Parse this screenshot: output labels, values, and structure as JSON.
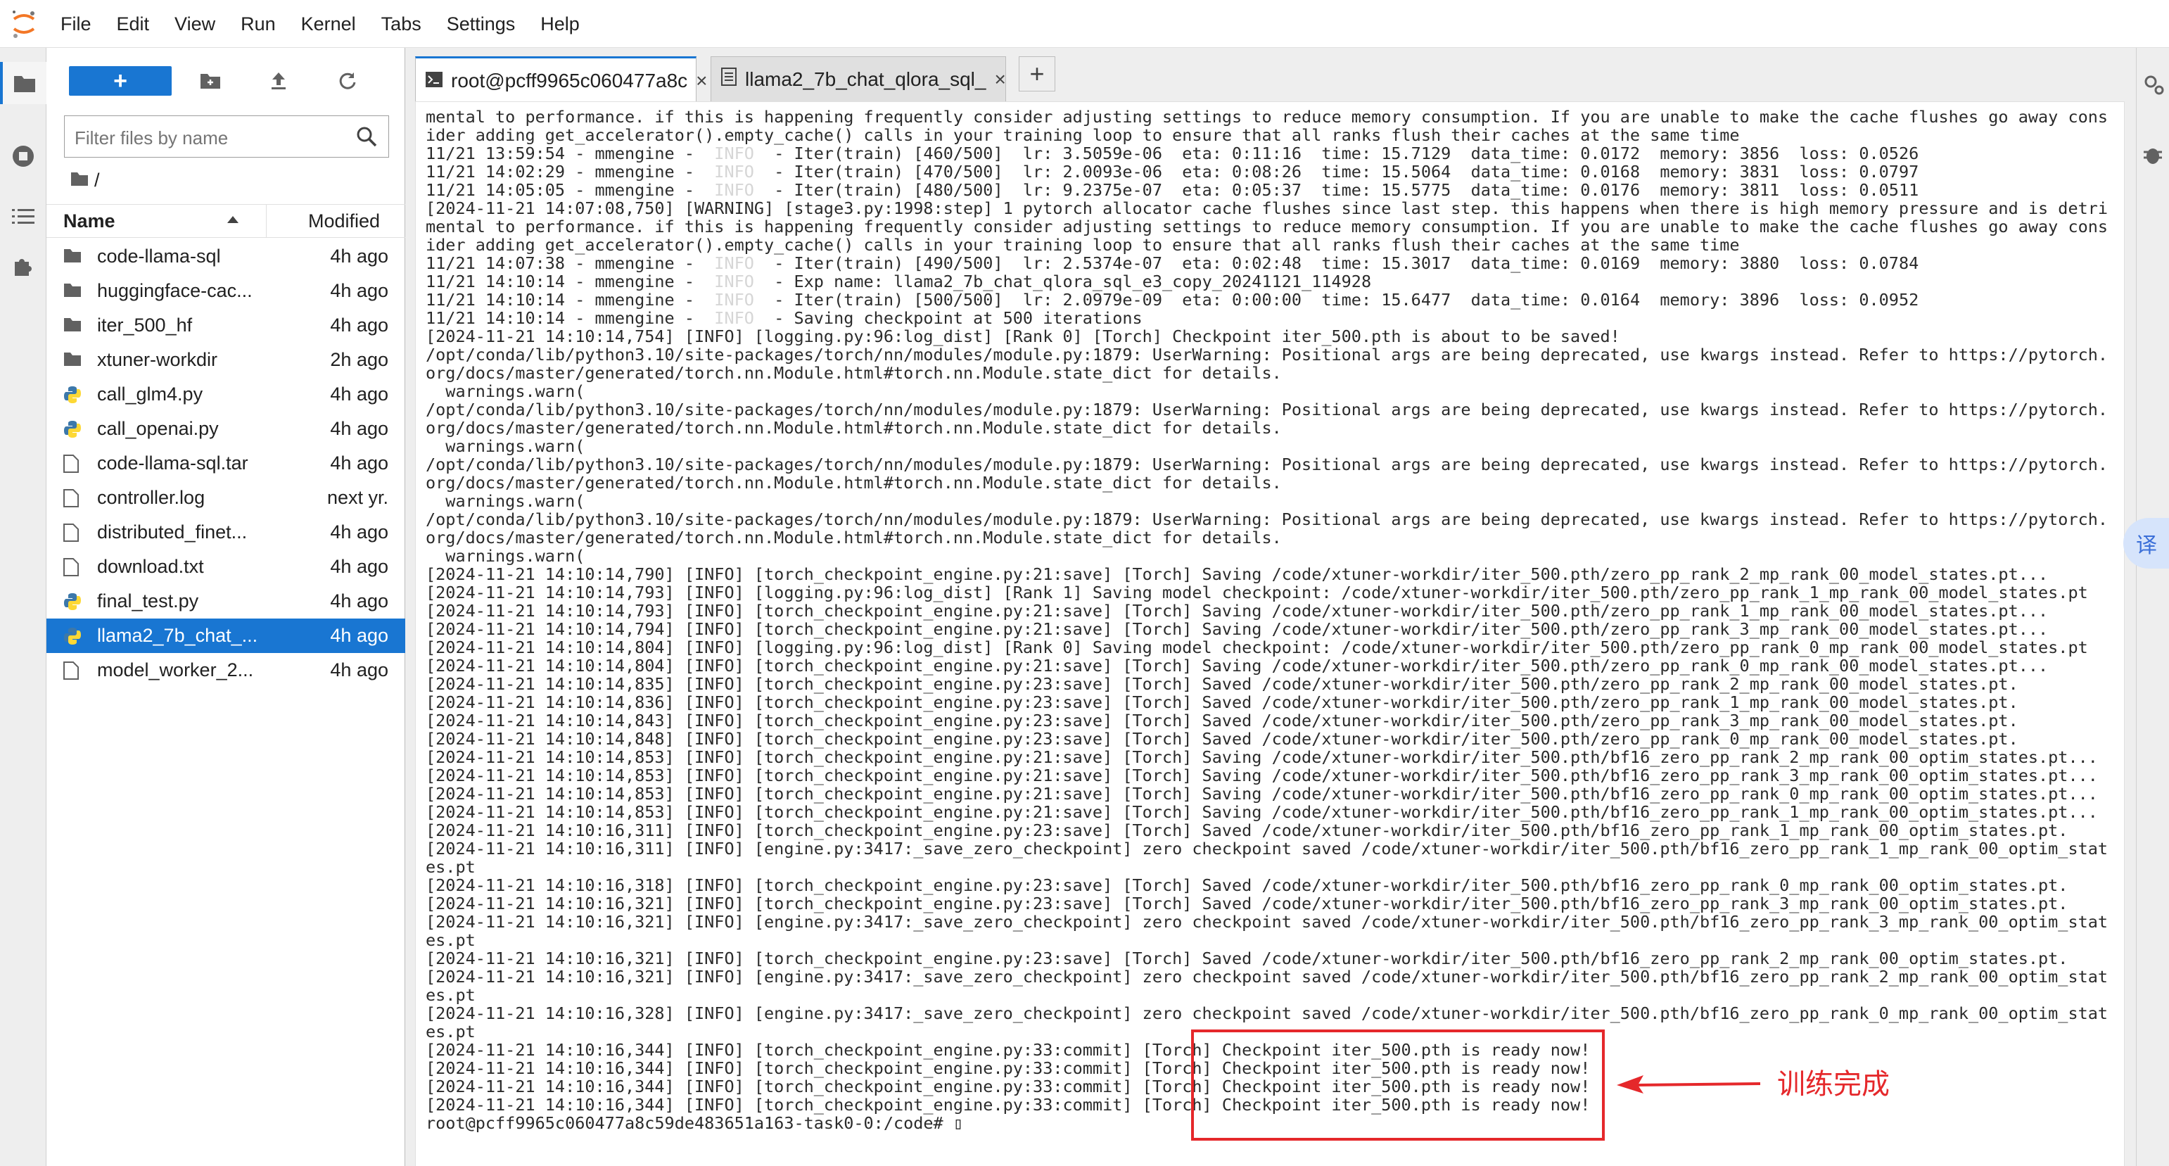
{
  "menubar": {
    "items": [
      "File",
      "Edit",
      "View",
      "Run",
      "Kernel",
      "Tabs",
      "Settings",
      "Help"
    ]
  },
  "filebrowser": {
    "new_label": "+",
    "filter_placeholder": "Filter files by name",
    "breadcrumb": "/",
    "col_name": "Name",
    "col_modified": "Modified",
    "files": [
      {
        "name": "code-llama-sql",
        "time": "4h ago",
        "type": "folder"
      },
      {
        "name": "huggingface-cac...",
        "time": "4h ago",
        "type": "folder"
      },
      {
        "name": "iter_500_hf",
        "time": "4h ago",
        "type": "folder"
      },
      {
        "name": "xtuner-workdir",
        "time": "2h ago",
        "type": "folder"
      },
      {
        "name": "call_glm4.py",
        "time": "4h ago",
        "type": "python"
      },
      {
        "name": "call_openai.py",
        "time": "4h ago",
        "type": "python"
      },
      {
        "name": "code-llama-sql.tar",
        "time": "4h ago",
        "type": "file"
      },
      {
        "name": "controller.log",
        "time": "next yr.",
        "type": "file"
      },
      {
        "name": "distributed_finet...",
        "time": "4h ago",
        "type": "file"
      },
      {
        "name": "download.txt",
        "time": "4h ago",
        "type": "file"
      },
      {
        "name": "final_test.py",
        "time": "4h ago",
        "type": "python"
      },
      {
        "name": "llama2_7b_chat_...",
        "time": "4h ago",
        "type": "python",
        "selected": true
      },
      {
        "name": "model_worker_2...",
        "time": "4h ago",
        "type": "file"
      }
    ]
  },
  "tabs": [
    {
      "label": "root@pcff9965c060477a8c",
      "close": "×"
    },
    {
      "label": "llama2_7b_chat_qlora_sql_",
      "close": "×"
    }
  ],
  "add_tab": "+",
  "terminal": {
    "lines": [
      "mental to performance. if this is happening frequently consider adjusting settings to reduce memory consumption. If you are unable to make the cache flushes go away cons",
      "ider adding get_accelerator().empty_cache() calls in your training loop to ensure that all ranks flush their caches at the same time",
      "11/21 13:59:54 - mmengine - |INFO| - Iter(train) [460/500]  lr: 3.5059e-06  eta: 0:11:16  time: 15.7129  data_time: 0.0172  memory: 3856  loss: 0.0526",
      "11/21 14:02:29 - mmengine - |INFO| - Iter(train) [470/500]  lr: 2.0093e-06  eta: 0:08:26  time: 15.5064  data_time: 0.0168  memory: 3831  loss: 0.0797",
      "11/21 14:05:05 - mmengine - |INFO| - Iter(train) [480/500]  lr: 9.2375e-07  eta: 0:05:37  time: 15.5775  data_time: 0.0176  memory: 3811  loss: 0.0511",
      "[2024-11-21 14:07:08,750] [WARNING] [stage3.py:1998:step] 1 pytorch allocator cache flushes since last step. this happens when there is high memory pressure and is detri",
      "mental to performance. if this is happening frequently consider adjusting settings to reduce memory consumption. If you are unable to make the cache flushes go away cons",
      "ider adding get_accelerator().empty_cache() calls in your training loop to ensure that all ranks flush their caches at the same time",
      "11/21 14:07:38 - mmengine - |INFO| - Iter(train) [490/500]  lr: 2.5374e-07  eta: 0:02:48  time: 15.3017  data_time: 0.0169  memory: 3880  loss: 0.0784",
      "11/21 14:10:14 - mmengine - |INFO| - Exp name: llama2_7b_chat_qlora_sql_e3_copy_20241121_114928",
      "11/21 14:10:14 - mmengine - |INFO| - Iter(train) [500/500]  lr: 2.0979e-09  eta: 0:00:00  time: 15.6477  data_time: 0.0164  memory: 3896  loss: 0.0952",
      "11/21 14:10:14 - mmengine - |INFO| - Saving checkpoint at 500 iterations",
      "[2024-11-21 14:10:14,754] [INFO] [logging.py:96:log_dist] [Rank 0] [Torch] Checkpoint iter_500.pth is about to be saved!",
      "/opt/conda/lib/python3.10/site-packages/torch/nn/modules/module.py:1879: UserWarning: Positional args are being deprecated, use kwargs instead. Refer to https://pytorch.",
      "org/docs/master/generated/torch.nn.Module.html#torch.nn.Module.state_dict for details.",
      "  warnings.warn(",
      "/opt/conda/lib/python3.10/site-packages/torch/nn/modules/module.py:1879: UserWarning: Positional args are being deprecated, use kwargs instead. Refer to https://pytorch.",
      "org/docs/master/generated/torch.nn.Module.html#torch.nn.Module.state_dict for details.",
      "  warnings.warn(",
      "/opt/conda/lib/python3.10/site-packages/torch/nn/modules/module.py:1879: UserWarning: Positional args are being deprecated, use kwargs instead. Refer to https://pytorch.",
      "org/docs/master/generated/torch.nn.Module.html#torch.nn.Module.state_dict for details.",
      "  warnings.warn(",
      "/opt/conda/lib/python3.10/site-packages/torch/nn/modules/module.py:1879: UserWarning: Positional args are being deprecated, use kwargs instead. Refer to https://pytorch.",
      "org/docs/master/generated/torch.nn.Module.html#torch.nn.Module.state_dict for details.",
      "  warnings.warn(",
      "[2024-11-21 14:10:14,790] [INFO] [torch_checkpoint_engine.py:21:save] [Torch] Saving /code/xtuner-workdir/iter_500.pth/zero_pp_rank_2_mp_rank_00_model_states.pt...",
      "[2024-11-21 14:10:14,793] [INFO] [logging.py:96:log_dist] [Rank 1] Saving model checkpoint: /code/xtuner-workdir/iter_500.pth/zero_pp_rank_1_mp_rank_00_model_states.pt",
      "[2024-11-21 14:10:14,793] [INFO] [torch_checkpoint_engine.py:21:save] [Torch] Saving /code/xtuner-workdir/iter_500.pth/zero_pp_rank_1_mp_rank_00_model_states.pt...",
      "[2024-11-21 14:10:14,794] [INFO] [torch_checkpoint_engine.py:21:save] [Torch] Saving /code/xtuner-workdir/iter_500.pth/zero_pp_rank_3_mp_rank_00_model_states.pt...",
      "[2024-11-21 14:10:14,804] [INFO] [logging.py:96:log_dist] [Rank 0] Saving model checkpoint: /code/xtuner-workdir/iter_500.pth/zero_pp_rank_0_mp_rank_00_model_states.pt",
      "[2024-11-21 14:10:14,804] [INFO] [torch_checkpoint_engine.py:21:save] [Torch] Saving /code/xtuner-workdir/iter_500.pth/zero_pp_rank_0_mp_rank_00_model_states.pt...",
      "[2024-11-21 14:10:14,835] [INFO] [torch_checkpoint_engine.py:23:save] [Torch] Saved /code/xtuner-workdir/iter_500.pth/zero_pp_rank_2_mp_rank_00_model_states.pt.",
      "[2024-11-21 14:10:14,836] [INFO] [torch_checkpoint_engine.py:23:save] [Torch] Saved /code/xtuner-workdir/iter_500.pth/zero_pp_rank_1_mp_rank_00_model_states.pt.",
      "[2024-11-21 14:10:14,843] [INFO] [torch_checkpoint_engine.py:23:save] [Torch] Saved /code/xtuner-workdir/iter_500.pth/zero_pp_rank_3_mp_rank_00_model_states.pt.",
      "[2024-11-21 14:10:14,848] [INFO] [torch_checkpoint_engine.py:23:save] [Torch] Saved /code/xtuner-workdir/iter_500.pth/zero_pp_rank_0_mp_rank_00_model_states.pt.",
      "[2024-11-21 14:10:14,853] [INFO] [torch_checkpoint_engine.py:21:save] [Torch] Saving /code/xtuner-workdir/iter_500.pth/bf16_zero_pp_rank_2_mp_rank_00_optim_states.pt...",
      "[2024-11-21 14:10:14,853] [INFO] [torch_checkpoint_engine.py:21:save] [Torch] Saving /code/xtuner-workdir/iter_500.pth/bf16_zero_pp_rank_3_mp_rank_00_optim_states.pt...",
      "[2024-11-21 14:10:14,853] [INFO] [torch_checkpoint_engine.py:21:save] [Torch] Saving /code/xtuner-workdir/iter_500.pth/bf16_zero_pp_rank_0_mp_rank_00_optim_states.pt...",
      "[2024-11-21 14:10:14,853] [INFO] [torch_checkpoint_engine.py:21:save] [Torch] Saving /code/xtuner-workdir/iter_500.pth/bf16_zero_pp_rank_1_mp_rank_00_optim_states.pt...",
      "[2024-11-21 14:10:16,311] [INFO] [torch_checkpoint_engine.py:23:save] [Torch] Saved /code/xtuner-workdir/iter_500.pth/bf16_zero_pp_rank_1_mp_rank_00_optim_states.pt.",
      "[2024-11-21 14:10:16,311] [INFO] [engine.py:3417:_save_zero_checkpoint] zero checkpoint saved /code/xtuner-workdir/iter_500.pth/bf16_zero_pp_rank_1_mp_rank_00_optim_stat",
      "es.pt",
      "[2024-11-21 14:10:16,318] [INFO] [torch_checkpoint_engine.py:23:save] [Torch] Saved /code/xtuner-workdir/iter_500.pth/bf16_zero_pp_rank_0_mp_rank_00_optim_states.pt.",
      "[2024-11-21 14:10:16,321] [INFO] [torch_checkpoint_engine.py:23:save] [Torch] Saved /code/xtuner-workdir/iter_500.pth/bf16_zero_pp_rank_3_mp_rank_00_optim_states.pt.",
      "[2024-11-21 14:10:16,321] [INFO] [engine.py:3417:_save_zero_checkpoint] zero checkpoint saved /code/xtuner-workdir/iter_500.pth/bf16_zero_pp_rank_3_mp_rank_00_optim_stat",
      "es.pt",
      "[2024-11-21 14:10:16,321] [INFO] [torch_checkpoint_engine.py:23:save] [Torch] Saved /code/xtuner-workdir/iter_500.pth/bf16_zero_pp_rank_2_mp_rank_00_optim_states.pt.",
      "[2024-11-21 14:10:16,321] [INFO] [engine.py:3417:_save_zero_checkpoint] zero checkpoint saved /code/xtuner-workdir/iter_500.pth/bf16_zero_pp_rank_2_mp_rank_00_optim_stat",
      "es.pt",
      "[2024-11-21 14:10:16,328] [INFO] [engine.py:3417:_save_zero_checkpoint] zero checkpoint saved /code/xtuner-workdir/iter_500.pth/bf16_zero_pp_rank_0_mp_rank_00_optim_stat",
      "es.pt",
      "[2024-11-21 14:10:16,344] [INFO] [torch_checkpoint_engine.py:33:commit] [Torch] Checkpoint iter_500.pth is ready now!",
      "[2024-11-21 14:10:16,344] [INFO] [torch_checkpoint_engine.py:33:commit] [Torch] Checkpoint iter_500.pth is ready now!",
      "[2024-11-21 14:10:16,344] [INFO] [torch_checkpoint_engine.py:33:commit] [Torch] Checkpoint iter_500.pth is ready now!",
      "[2024-11-21 14:10:16,344] [INFO] [torch_checkpoint_engine.py:33:commit] [Torch] Checkpoint iter_500.pth is ready now!",
      "root@pcff9965c060477a8c59de483651a163-task0-0:/code# ▯"
    ]
  },
  "annotation": {
    "label": "训练完成",
    "color": "#e5282b"
  },
  "translate_label": "译",
  "colors": {
    "accent": "#1976d2",
    "annotation": "#e5282b"
  }
}
